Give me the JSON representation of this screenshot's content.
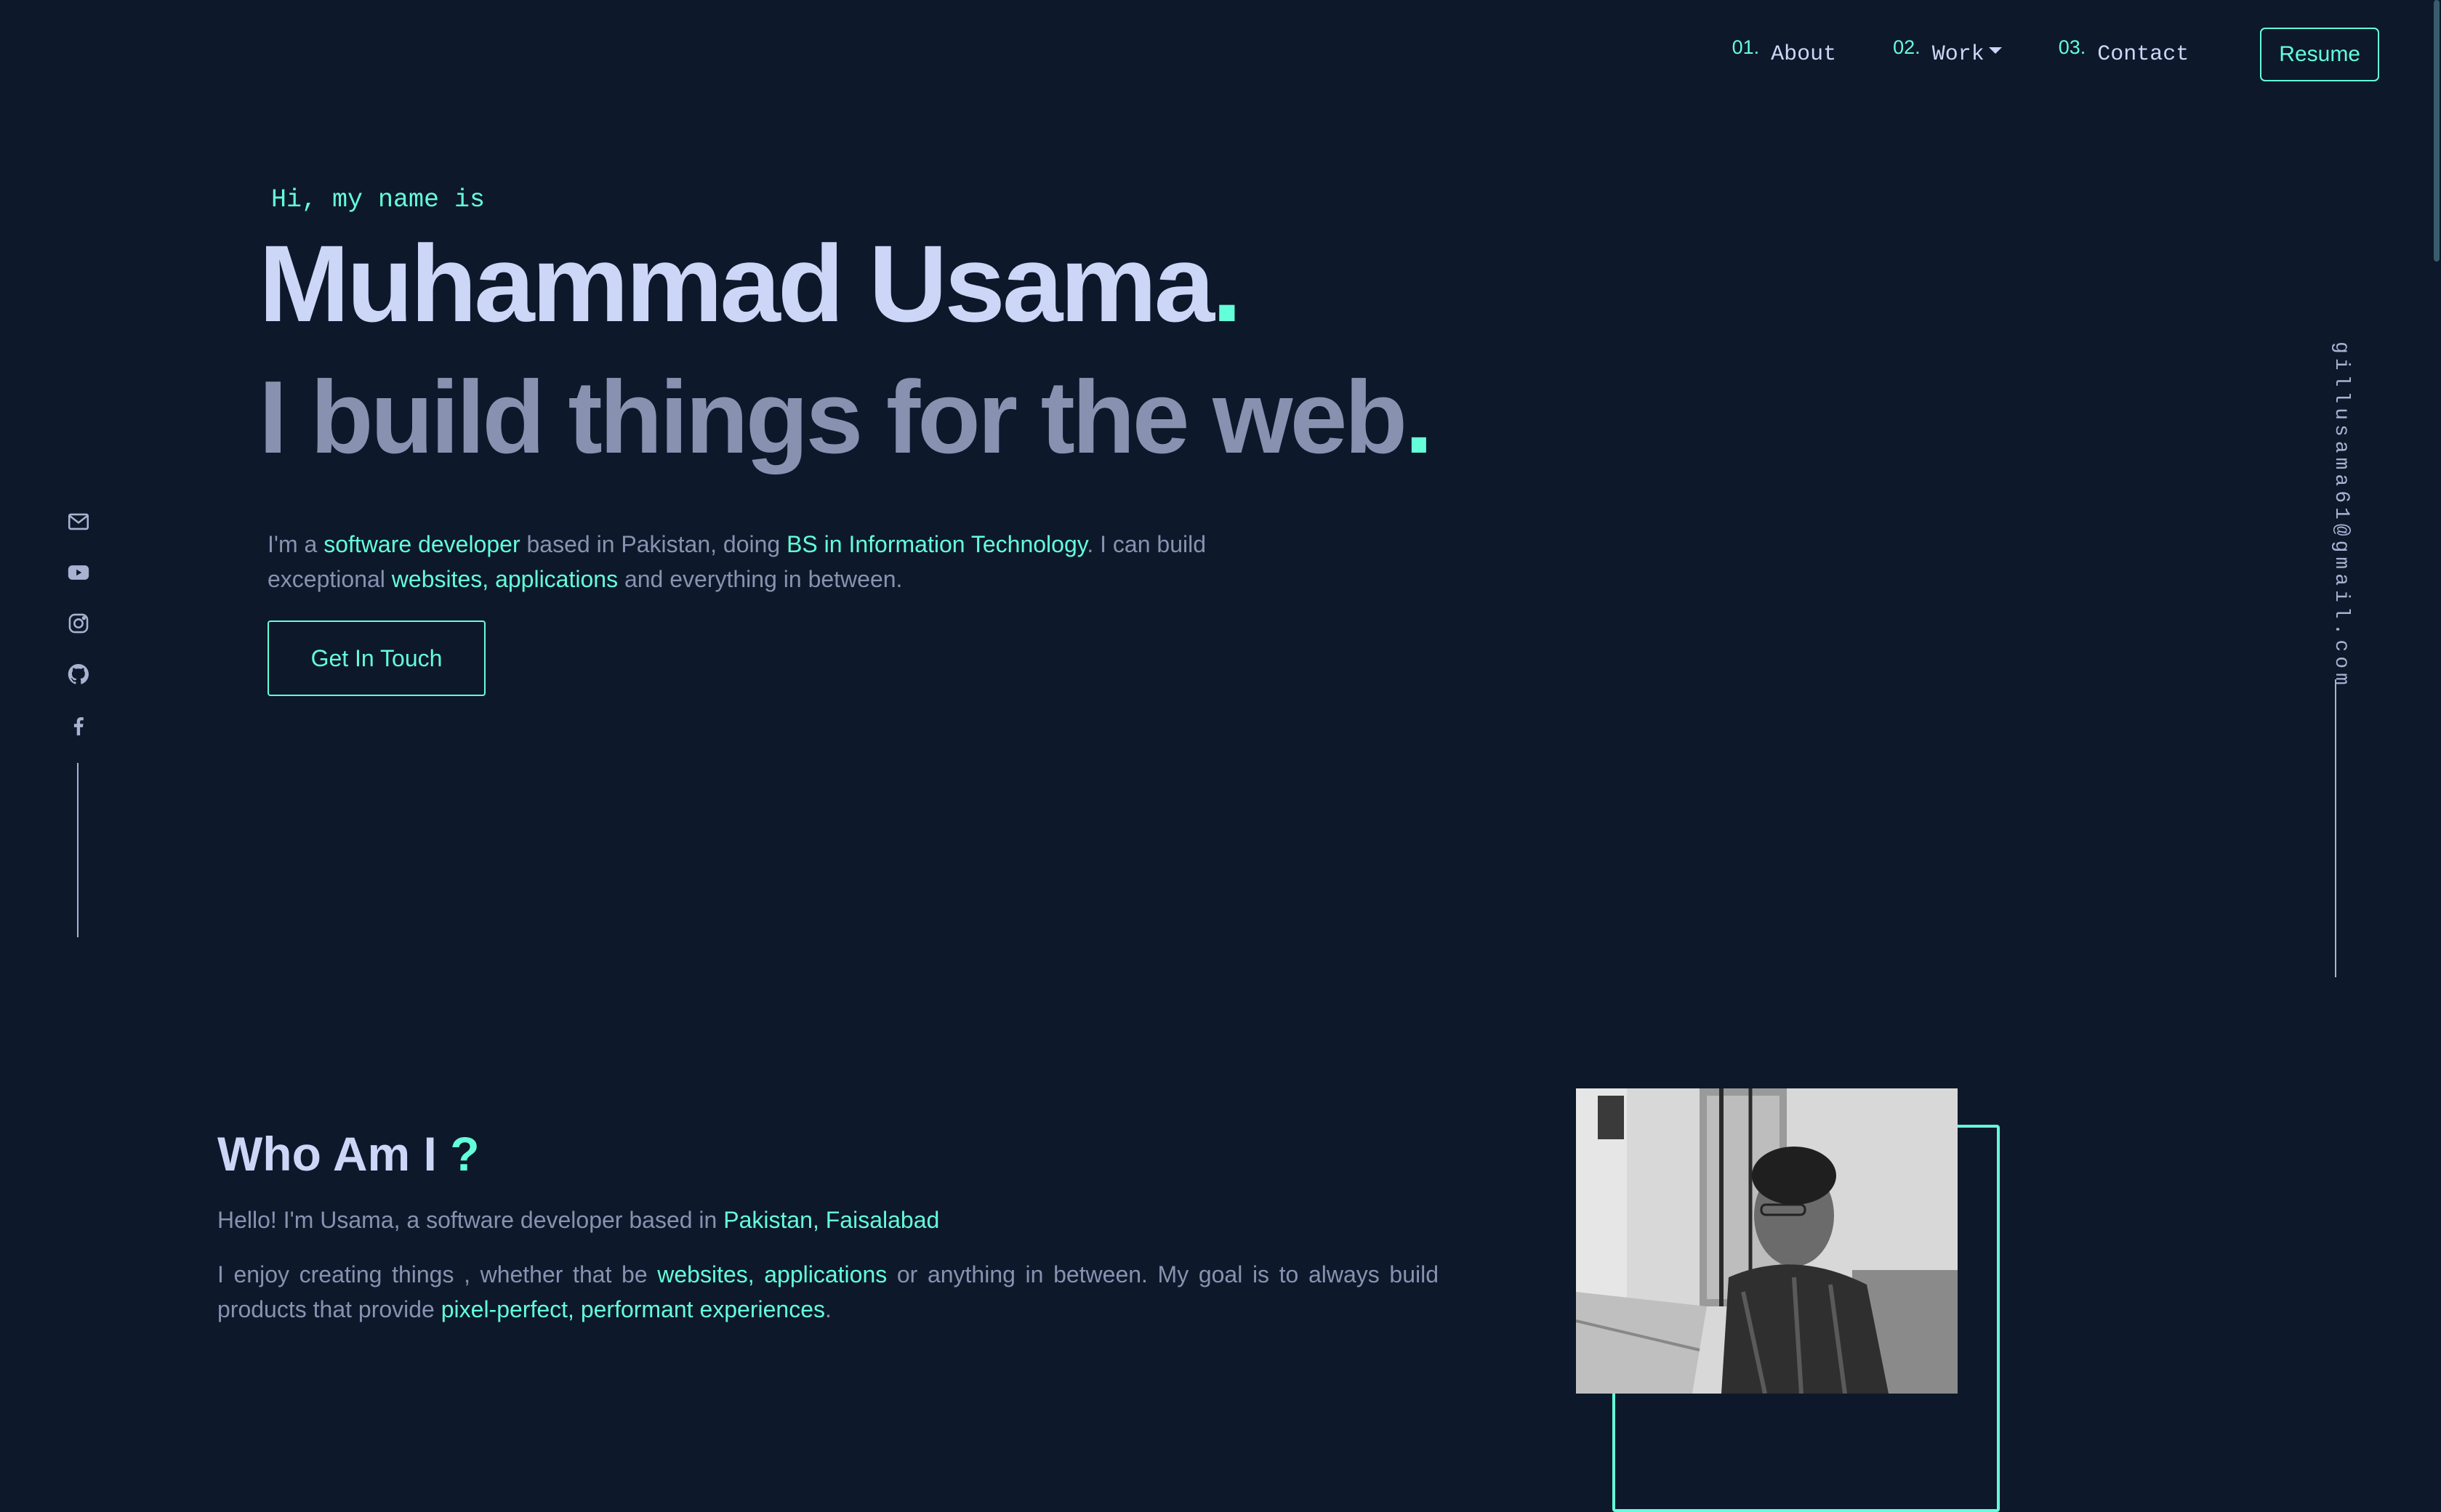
{
  "nav": {
    "items": [
      {
        "num": "01.",
        "label": "About"
      },
      {
        "num": "02.",
        "label": "Work"
      },
      {
        "num": "03.",
        "label": "Contact"
      }
    ],
    "resume_label": "Resume"
  },
  "hero": {
    "greeting": "Hi, my name is",
    "name": "Muhammad Usama",
    "name_dot": ".",
    "tagline": "I build things for the web",
    "tagline_dot": ".",
    "desc": {
      "t1": "I'm a ",
      "h1": "software developer",
      "t2": " based in Pakistan, doing ",
      "h2": "BS in Information Technology",
      "t3": ". I can build exceptional ",
      "h3": "websites, applications",
      "t4": " and everything in between."
    },
    "cta_label": "Get In Touch"
  },
  "socials": [
    {
      "icon": "mail-icon"
    },
    {
      "icon": "youtube-icon"
    },
    {
      "icon": "instagram-icon"
    },
    {
      "icon": "github-icon"
    },
    {
      "icon": "facebook-icon"
    }
  ],
  "email": "gillusama61@gmail.com",
  "about": {
    "title": "Who Am I",
    "title_mark": "?",
    "p1_text": "Hello! I'm Usama, a software developer based in ",
    "p1_highlight": "Pakistan, Faisalabad",
    "p2_t1": "I enjoy creating things , whether that be ",
    "p2_h1": "websites, applications",
    "p2_t2": " or anything in between. My goal is to always build products that provide ",
    "p2_h2": "pixel-perfect, performant experiences",
    "p2_t3": "."
  },
  "colors": {
    "background": "#0d182b",
    "accent": "#64ffda",
    "heading": "#ccd6f6",
    "text": "#8892b0"
  }
}
